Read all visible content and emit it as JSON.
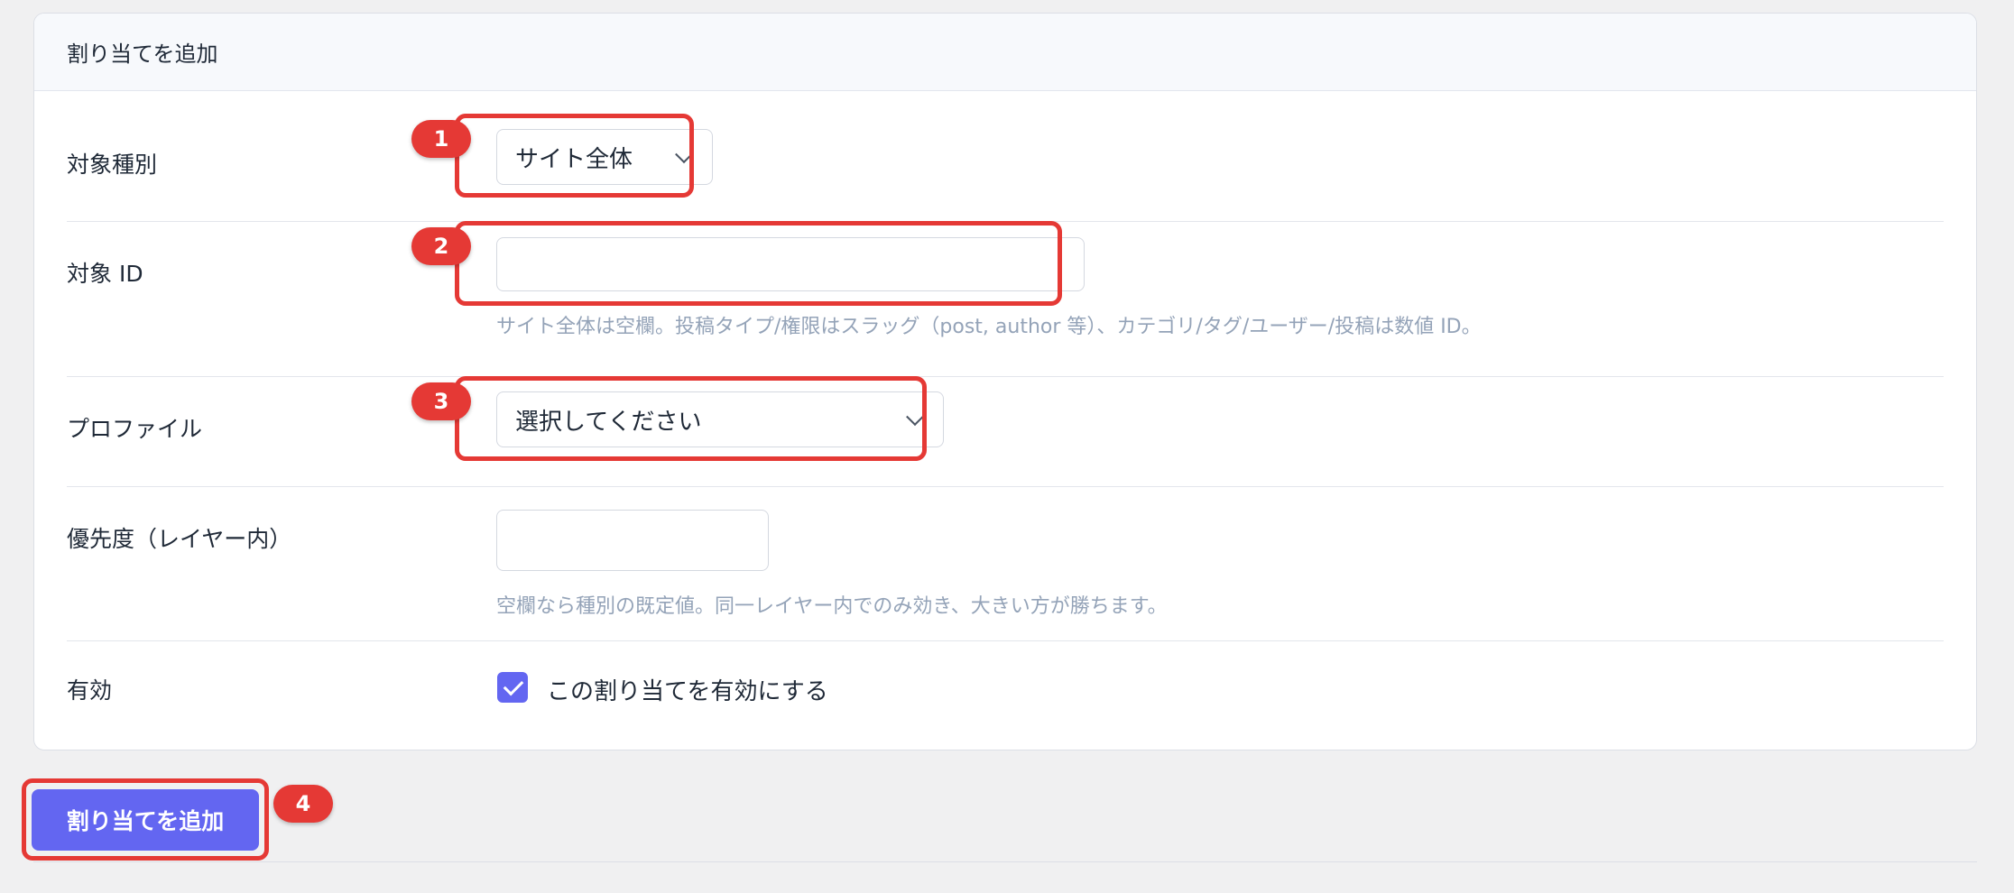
{
  "panel": {
    "title": "割り当てを追加"
  },
  "fields": {
    "target_type": {
      "label": "対象種別",
      "selected": "サイト全体"
    },
    "target_id": {
      "label": "対象 ID",
      "value": "",
      "help": "サイト全体は空欄。投稿タイプ/権限はスラッグ（post, author 等）、カテゴリ/タグ/ユーザー/投稿は数値 ID。"
    },
    "profile": {
      "label": "プロファイル",
      "selected": "選択してください"
    },
    "priority": {
      "label": "優先度（レイヤー内）",
      "value": "",
      "help": "空欄なら種別の既定値。同一レイヤー内でのみ効き、大きい方が勝ちます。"
    },
    "enabled": {
      "label": "有効",
      "checkbox_label": "この割り当てを有効にする",
      "checked": true
    }
  },
  "submit": {
    "label": "割り当てを追加"
  },
  "badges": [
    "1",
    "2",
    "3",
    "4"
  ],
  "colors": {
    "accent": "#6366f1",
    "highlight": "#e53935"
  }
}
